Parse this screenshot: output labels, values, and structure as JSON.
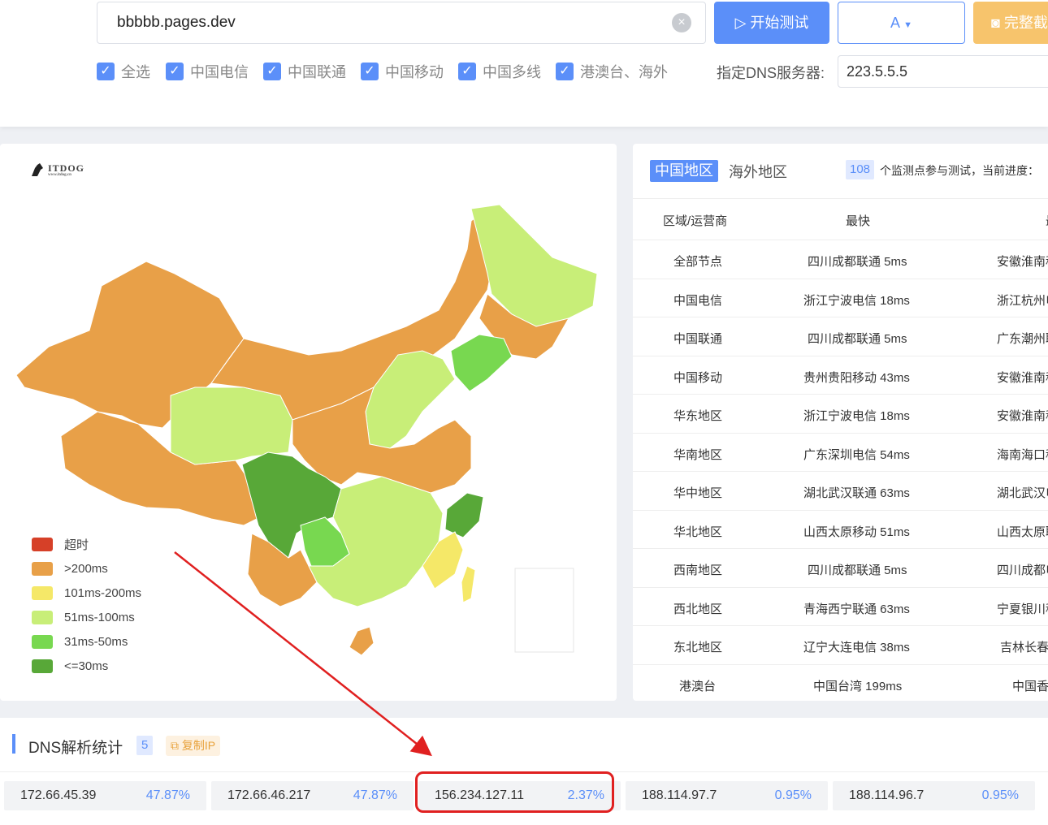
{
  "toolbar": {
    "url_value": "bbbbb.pages.dev",
    "start_label": "开始测试",
    "type_label": "A",
    "screenshot_label": "完整截",
    "checkboxes": [
      "全选",
      "中国电信",
      "中国联通",
      "中国移动",
      "中国多线",
      "港澳台、海外"
    ],
    "dns_label": "指定DNS服务器:",
    "dns_value": "223.5.5.5"
  },
  "map": {
    "logo_text": "ITDOG",
    "logo_sub": "www.itdog.cn",
    "legend": [
      {
        "label": "超时",
        "color": "#d64028"
      },
      {
        "label": ">200ms",
        "color": "#e8a048"
      },
      {
        "label": "101ms-200ms",
        "color": "#f5e868"
      },
      {
        "label": "51ms-100ms",
        "color": "#c8ee78"
      },
      {
        "label": "31ms-50ms",
        "color": "#78d850"
      },
      {
        "label": "<=30ms",
        "color": "#58a838"
      }
    ]
  },
  "results": {
    "tabs": [
      "中国地区",
      "海外地区"
    ],
    "node_count": "108",
    "progress_text": "个监测点参与测试，当前进度：",
    "headers": [
      "区域/运营商",
      "最快",
      "最"
    ],
    "rows": [
      {
        "region": "全部节点",
        "fastest": "四川成都联通 5ms",
        "slowest": "安徽淮南移"
      },
      {
        "region": "中国电信",
        "fastest": "浙江宁波电信 18ms",
        "slowest": "浙江杭州电"
      },
      {
        "region": "中国联通",
        "fastest": "四川成都联通 5ms",
        "slowest": "广东潮州联"
      },
      {
        "region": "中国移动",
        "fastest": "贵州贵阳移动 43ms",
        "slowest": "安徽淮南移"
      },
      {
        "region": "华东地区",
        "fastest": "浙江宁波电信 18ms",
        "slowest": "安徽淮南移"
      },
      {
        "region": "华南地区",
        "fastest": "广东深圳电信 54ms",
        "slowest": "海南海口移"
      },
      {
        "region": "华中地区",
        "fastest": "湖北武汉联通 63ms",
        "slowest": "湖北武汉电"
      },
      {
        "region": "华北地区",
        "fastest": "山西太原移动 51ms",
        "slowest": "山西太原联"
      },
      {
        "region": "西南地区",
        "fastest": "四川成都联通 5ms",
        "slowest": "四川成都电"
      },
      {
        "region": "西北地区",
        "fastest": "青海西宁联通 63ms",
        "slowest": "宁夏银川移"
      },
      {
        "region": "东北地区",
        "fastest": "辽宁大连电信 38ms",
        "slowest": "吉林长春电"
      },
      {
        "region": "港澳台",
        "fastest": "中国台湾 199ms",
        "slowest": "中国香"
      }
    ]
  },
  "dns_stats": {
    "title": "DNS解析统计",
    "count": "5",
    "copy_label": "复制IP",
    "items": [
      {
        "ip": "172.66.45.39",
        "pct": "47.87%"
      },
      {
        "ip": "172.66.46.217",
        "pct": "47.87%"
      },
      {
        "ip": "156.234.127.11",
        "pct": "2.37%"
      },
      {
        "ip": "188.114.97.7",
        "pct": "0.95%"
      },
      {
        "ip": "188.114.96.7",
        "pct": "0.95%"
      }
    ]
  }
}
